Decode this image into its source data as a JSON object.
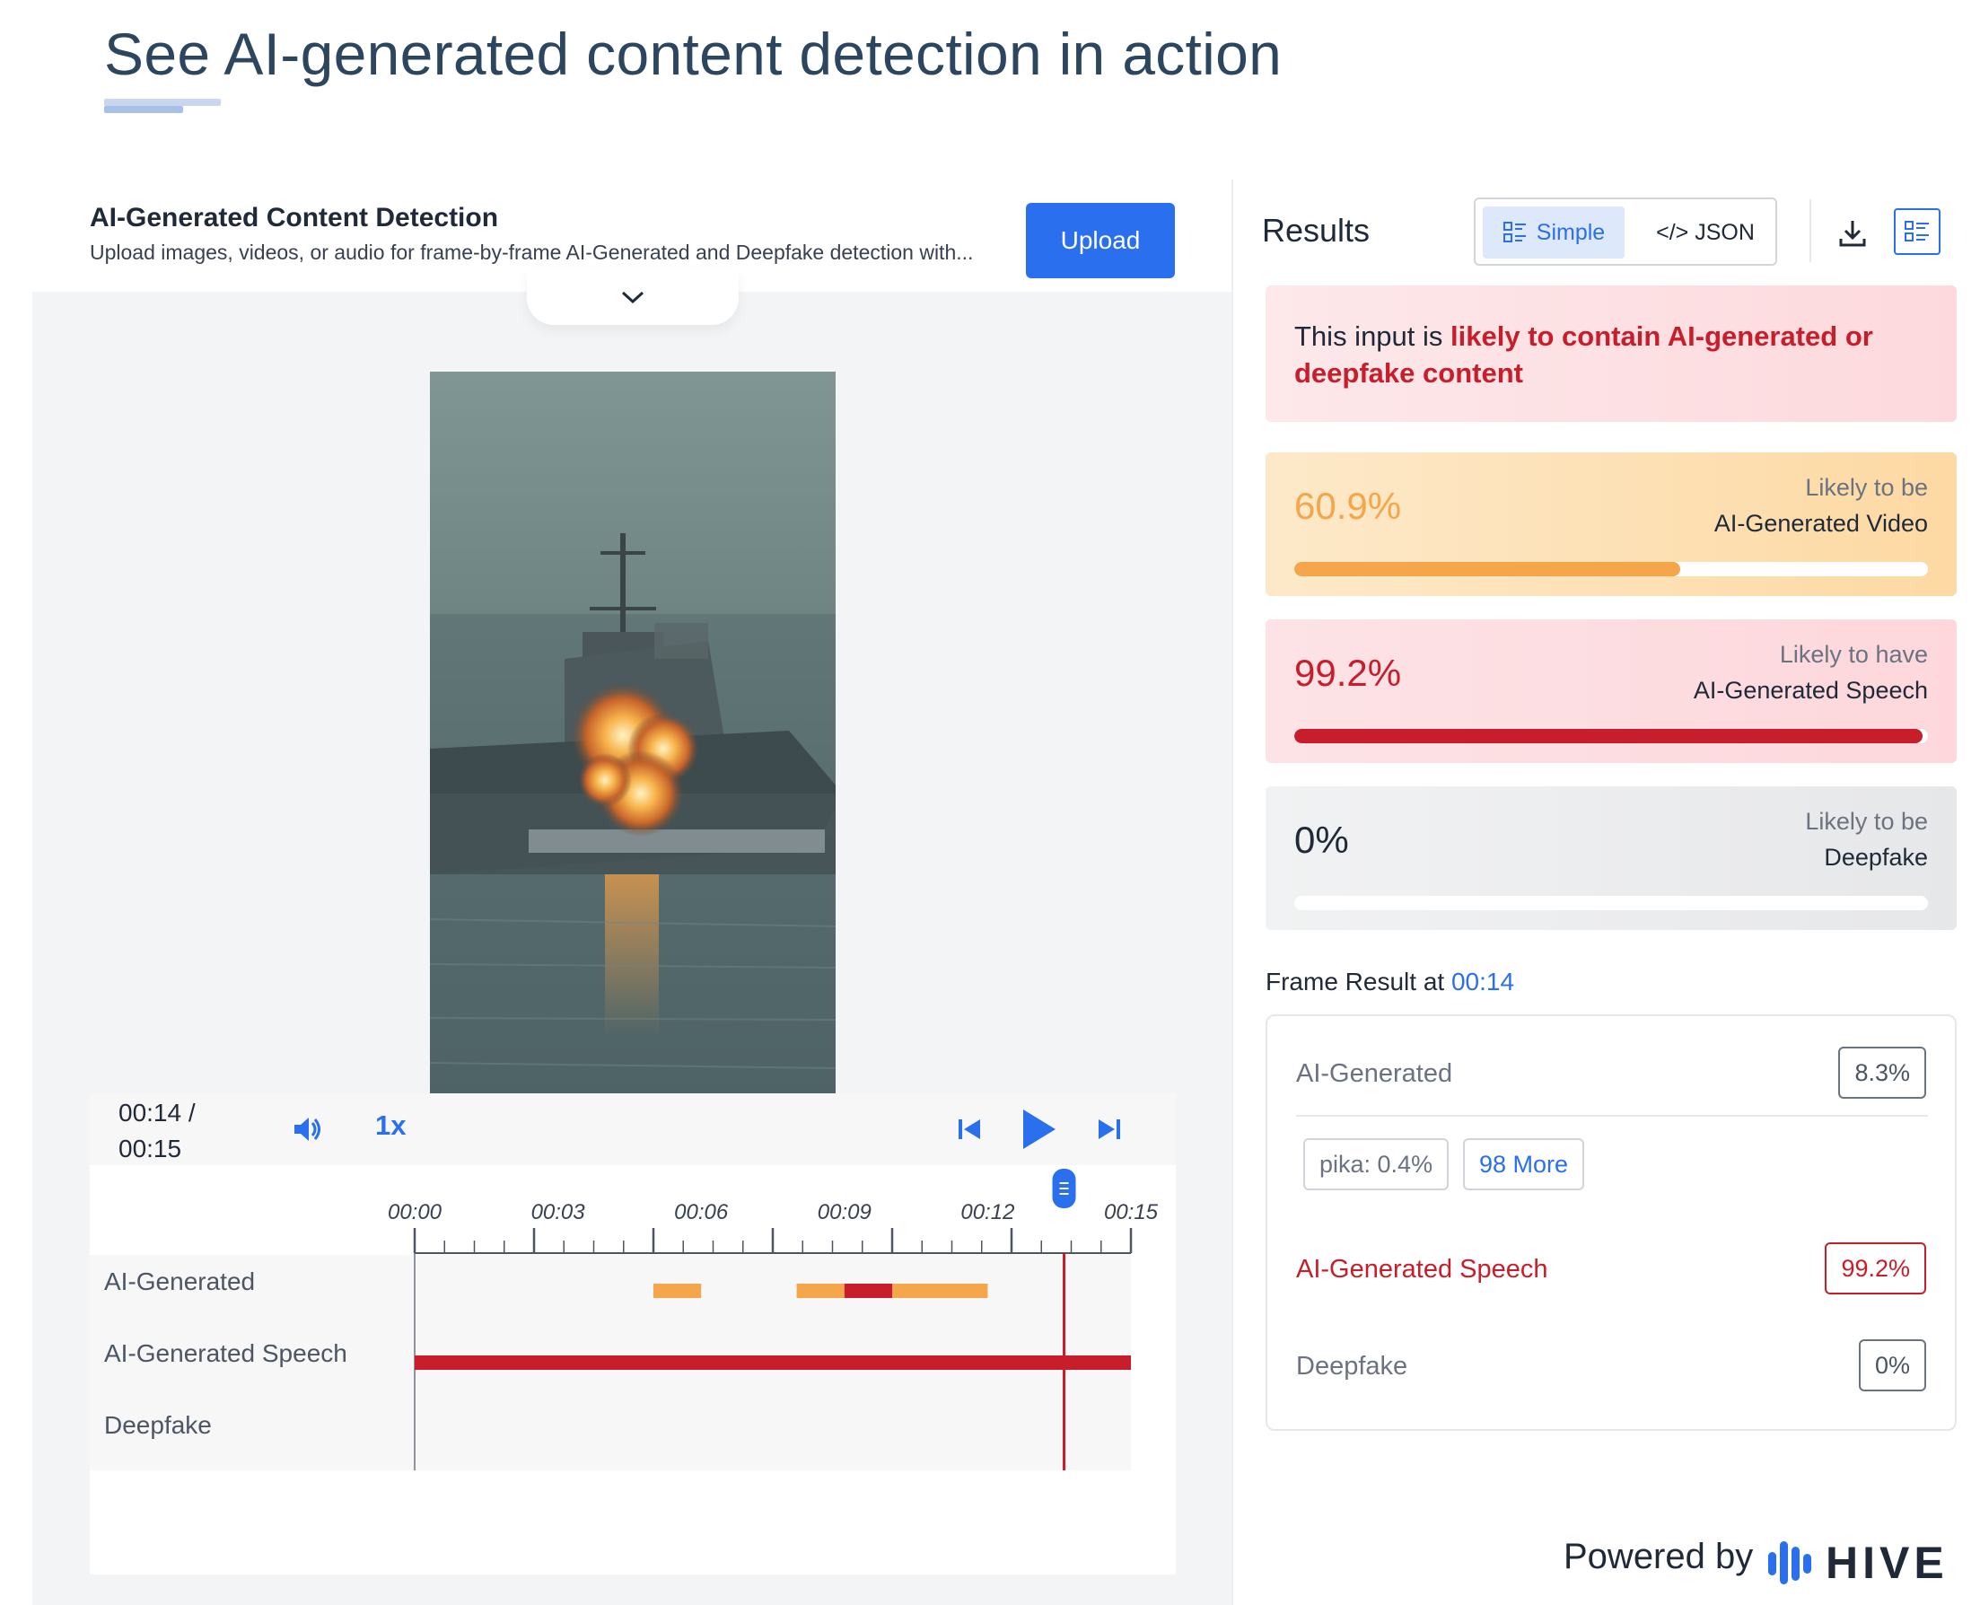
{
  "page": {
    "title": "See AI-generated content detection in action"
  },
  "detector": {
    "title": "AI-Generated Content Detection",
    "subtitle": "Upload images, videos, or audio for frame-by-frame AI-Generated and Deepfake detection with...",
    "upload_label": "Upload"
  },
  "player": {
    "time_current": "00:14 /",
    "time_total": "00:15",
    "speed": "1x",
    "playhead_seconds": 13.6,
    "duration_seconds": 15,
    "ticks": [
      "00:00",
      "00:03",
      "00:06",
      "00:09",
      "00:12",
      "00:15"
    ],
    "tracks": [
      {
        "label": "AI-Generated"
      },
      {
        "label": "AI-Generated Speech"
      },
      {
        "label": "Deepfake"
      }
    ],
    "segments": {
      "ai_generated": [
        {
          "start": 5.0,
          "end": 6.0,
          "level": "medium"
        },
        {
          "start": 8.0,
          "end": 9.0,
          "level": "medium"
        },
        {
          "start": 9.0,
          "end": 10.0,
          "level": "high"
        },
        {
          "start": 10.0,
          "end": 12.0,
          "level": "medium"
        }
      ],
      "speech": [
        {
          "start": 0,
          "end": 15,
          "level": "high"
        }
      ]
    },
    "colors": {
      "medium": "#f5a54a",
      "high": "#c81e2b",
      "accent": "#2a6fee"
    }
  },
  "results": {
    "title": "Results",
    "toggle_simple": "Simple",
    "toggle_json": "</> JSON",
    "summary_prefix": "This input is ",
    "summary_highlight": "likely to contain AI-generated or deepfake content",
    "cards": [
      {
        "pct": "60.9%",
        "value": 0.609,
        "line1": "Likely to be",
        "line2": "AI-Generated Video",
        "color": "#f5a54a"
      },
      {
        "pct": "99.2%",
        "value": 0.992,
        "line1": "Likely to have",
        "line2": "AI-Generated Speech",
        "color": "#c81e2b"
      },
      {
        "pct": "0%",
        "value": 0,
        "line1": "Likely to be",
        "line2": "Deepfake",
        "color": "#9ca3af"
      }
    ],
    "frame_result_label": "Frame Result at ",
    "frame_result_time": "00:14",
    "frame": {
      "ai_generated_label": "AI-Generated",
      "ai_generated_value": "8.3%",
      "chip_pika": "pika: 0.4%",
      "chip_more": "98 More",
      "speech_label": "AI-Generated Speech",
      "speech_value": "99.2%",
      "deepfake_label": "Deepfake",
      "deepfake_value": "0%"
    }
  },
  "footer": {
    "powered_by": "Powered by",
    "brand": "HIVE"
  }
}
